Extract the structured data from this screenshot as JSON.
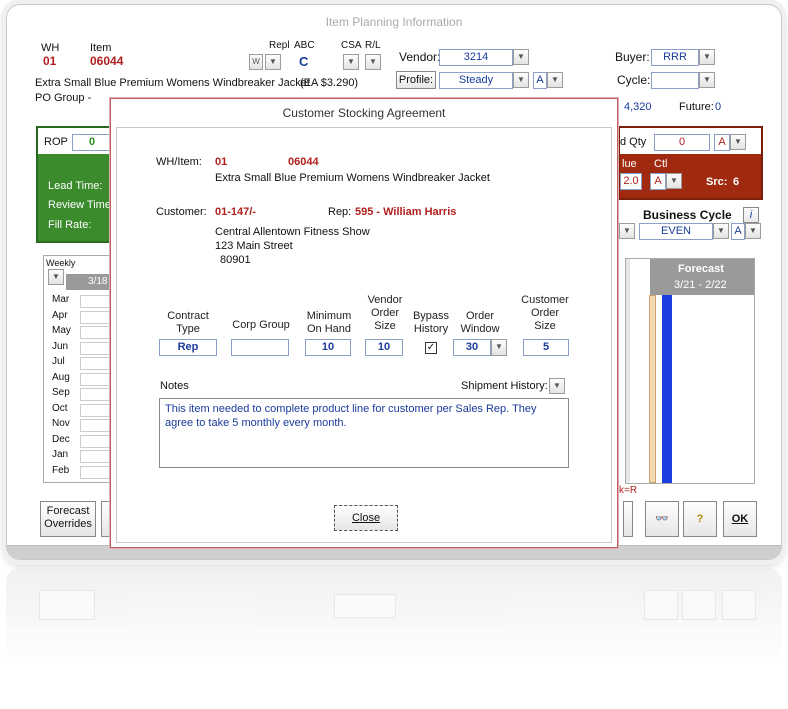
{
  "window": {
    "title": "Item Planning Information",
    "wh_label": "WH",
    "wh_value": "01",
    "item_label": "Item",
    "item_value": "06044",
    "repl_label": "Repl",
    "repl_value": "W",
    "abc_label": "ABC",
    "abc_value": "C",
    "csa_label": "CSA",
    "rl_label": "R/L",
    "vendor_label": "Vendor:",
    "vendor_value": "3214",
    "profile_button": "Profile:",
    "profile_value": "Steady",
    "profile_flag": "A",
    "buyer_label": "Buyer:",
    "buyer_value": "RRR",
    "cycle_label": "Cycle:",
    "cycle_value": "",
    "description": "Extra Small Blue Premium Womens Windbreaker Jacket",
    "uom_price": "(EA  $3.290)",
    "po_group_label": "PO Group -",
    "onhand_value": "4,320",
    "future_label": "Future:",
    "future_value": "0",
    "rop_label": "ROP",
    "rop_value": "0",
    "lead_time_label": "Lead Time:",
    "review_time_label": "Review Time",
    "fill_rate_label": "Fill Rate:",
    "order_qty_label": "d Qty",
    "order_qty_value": "0",
    "order_qty_flag": "A",
    "value_label": "lue",
    "ctl_label": "Ctl",
    "value_value": "2.0",
    "value_flag": "A",
    "src_label": "Src:",
    "src_value": "6",
    "business_cycle_label": "Business Cycle",
    "business_cycle_value": "EVEN",
    "business_cycle_flag": "A",
    "weekly_label": "Weekly",
    "weekly_range": "3/18 -",
    "months": [
      "Mar",
      "Apr",
      "May",
      "Jun",
      "Jul",
      "Aug",
      "Sep",
      "Oct",
      "Nov",
      "Dec",
      "Jan",
      "Feb"
    ],
    "forecast_label": "Forecast",
    "forecast_range": "3/21 - 2/22",
    "legend_fragment": "k=R",
    "forecast_overrides_button": "Forecast Overrides",
    "ok_button": "OK",
    "info_icon_label": "i"
  },
  "dialog": {
    "title": "Customer Stocking Agreement",
    "wh_item_label": "WH/Item:",
    "wh_value": "01",
    "item_value": "06044",
    "item_description": "Extra Small Blue Premium Womens Windbreaker Jacket",
    "customer_label": "Customer:",
    "customer_value": "01-147/-",
    "rep_label": "Rep:",
    "rep_value": "595 - William Harris",
    "address_line1": "Central Allentown Fitness Show",
    "address_line2": "123 Main Street",
    "address_line3": "80901",
    "headers": {
      "contract_type": "Contract Type",
      "corp_group": "Corp Group",
      "minimum_on_hand": "Minimum On Hand",
      "vendor_order_size": "Vendor Order Size",
      "bypass_history": "Bypass History",
      "order_window": "Order Window",
      "customer_order_size": "Customer Order Size"
    },
    "values": {
      "contract_type": "Rep",
      "corp_group": "",
      "minimum_on_hand": "10",
      "vendor_order_size": "10",
      "bypass_history_checked": true,
      "order_window": "30",
      "customer_order_size": "5"
    },
    "notes_label": "Notes",
    "shipment_history_label": "Shipment History:",
    "notes_text": "This item needed to complete product line for customer per Sales Rep.  They agree to take 5 monthly every month.",
    "close_button": "Close"
  },
  "colors": {
    "accent_red": "#b0201e",
    "field_blue": "#1a3b9c",
    "green_panel": "#3b8a2c",
    "red_panel": "#a02a10",
    "forecast_header": "#9a9a9a",
    "blue_bar": "#1c3ee0",
    "tan_bar": "#f2d9b0"
  }
}
